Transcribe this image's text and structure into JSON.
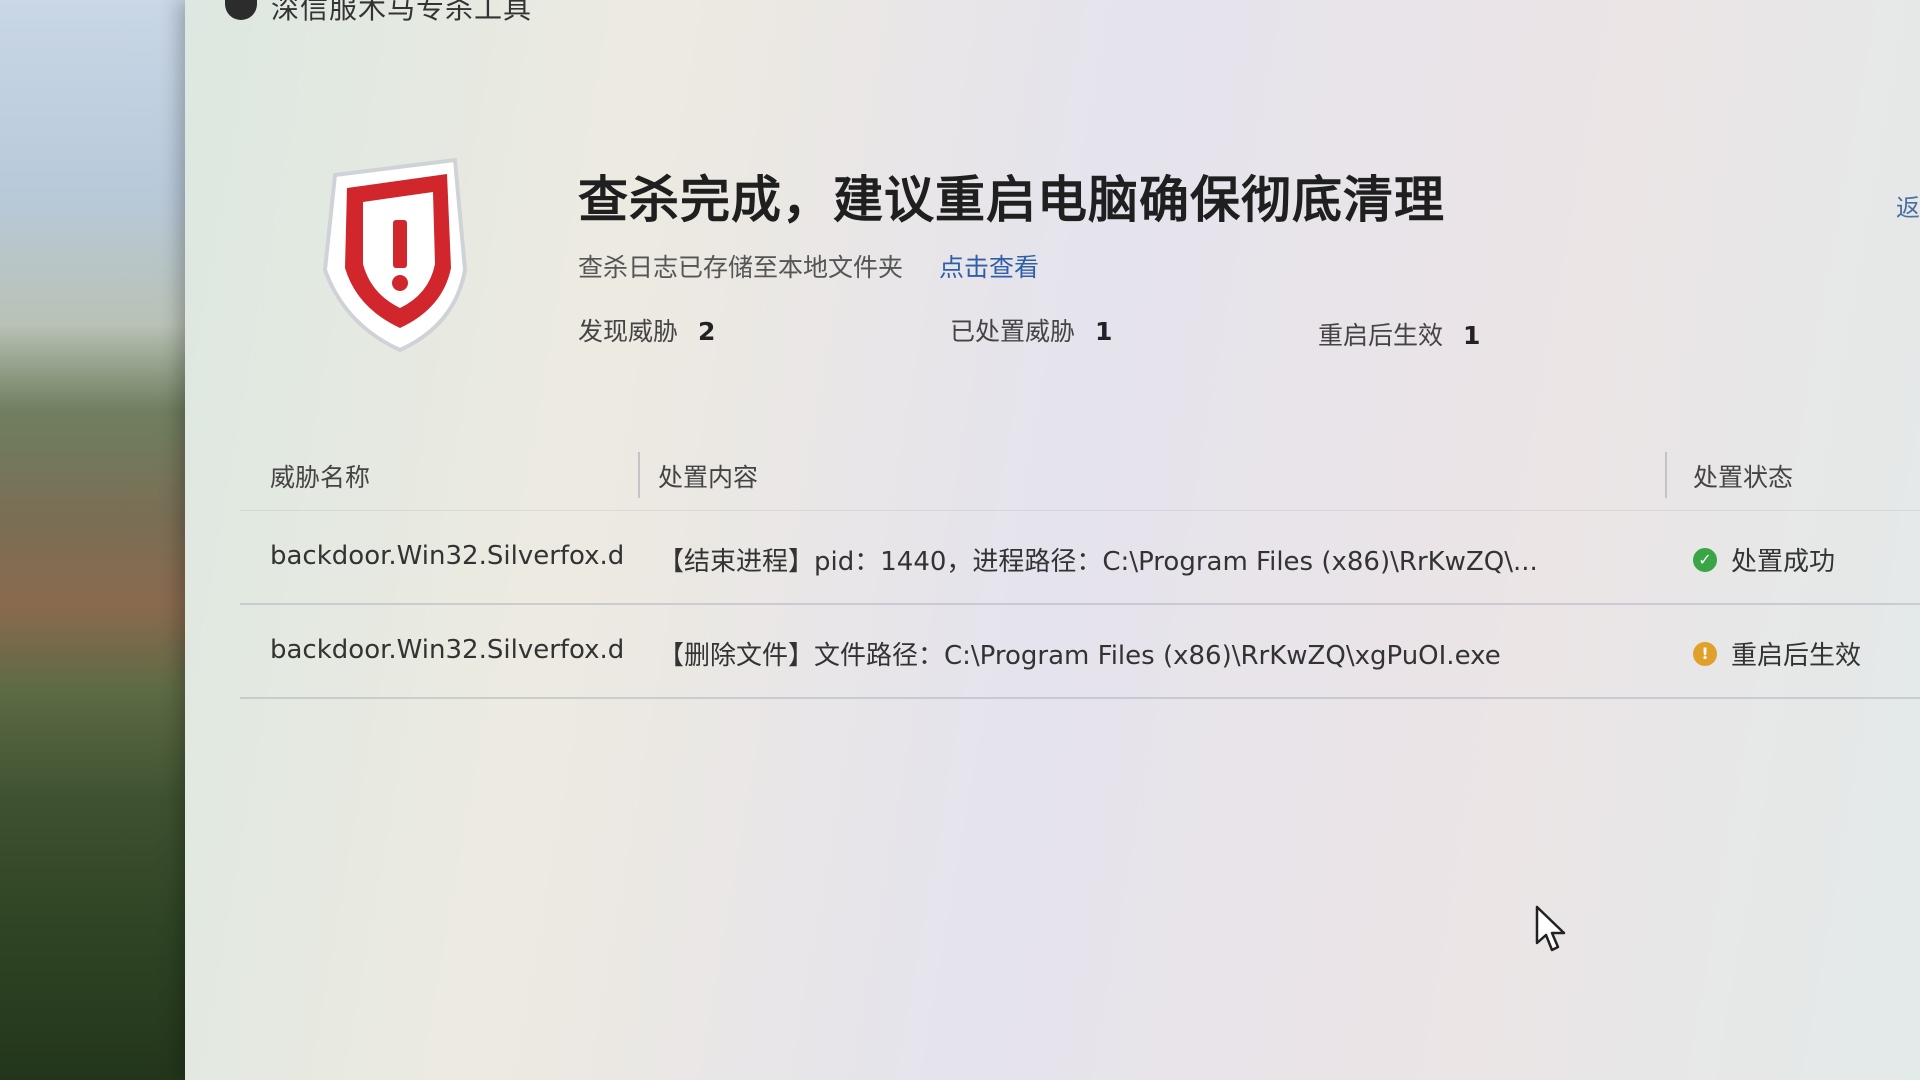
{
  "window": {
    "title": "深信服木马专杀工具",
    "back_label": "返"
  },
  "result": {
    "headline": "查杀完成，建议重启电脑确保彻底清理",
    "log_text": "查杀日志已存储至本地文件夹",
    "log_link": "点击查看"
  },
  "stats": {
    "found_label": "发现威胁",
    "found_value": "2",
    "handled_label": "已处置威胁",
    "handled_value": "1",
    "restart_label": "重启后生效",
    "restart_value": "1"
  },
  "table": {
    "headers": {
      "name": "威胁名称",
      "content": "处置内容",
      "status": "处置状态"
    },
    "rows": [
      {
        "name": "backdoor.Win32.Silverfox.d",
        "content": "【结束进程】pid：1440，进程路径：C:\\Program Files (x86)\\RrKwZQ\\...",
        "status": "处置成功",
        "status_icon": "check-circle-icon",
        "status_color": "#3aa544"
      },
      {
        "name": "backdoor.Win32.Silverfox.d",
        "content": "【删除文件】文件路径：C:\\Program Files (x86)\\RrKwZQ\\xgPuOI.exe",
        "status": "重启后生效",
        "status_icon": "warning-circle-icon",
        "status_color": "#e0a02a"
      }
    ]
  },
  "colors": {
    "shield_red": "#d0262c",
    "link_blue": "#2f5fa8"
  }
}
